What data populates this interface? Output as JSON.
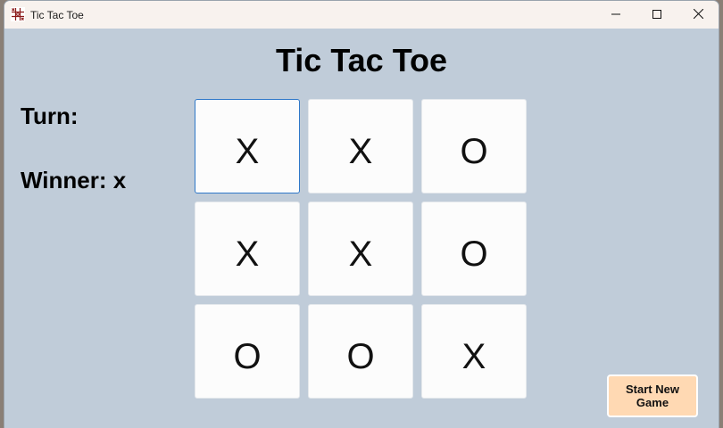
{
  "window": {
    "title": "Tic Tac Toe",
    "icon": "tic-tac-toe-app-icon",
    "controls": [
      "minimize-icon",
      "maximize-icon",
      "close-icon"
    ]
  },
  "main": {
    "heading": "Tic Tac Toe",
    "turn_label": "Turn:",
    "winner_label": "Winner: x"
  },
  "board": {
    "cells": [
      [
        "X",
        "X",
        "O"
      ],
      [
        "X",
        "X",
        "O"
      ],
      [
        "O",
        "O",
        "X"
      ]
    ]
  },
  "buttons": {
    "new_game": "Start New\nGame"
  },
  "colors": {
    "background": "#c0ccd9",
    "button": "#ffd9b3",
    "focus": "#2f78c9"
  }
}
